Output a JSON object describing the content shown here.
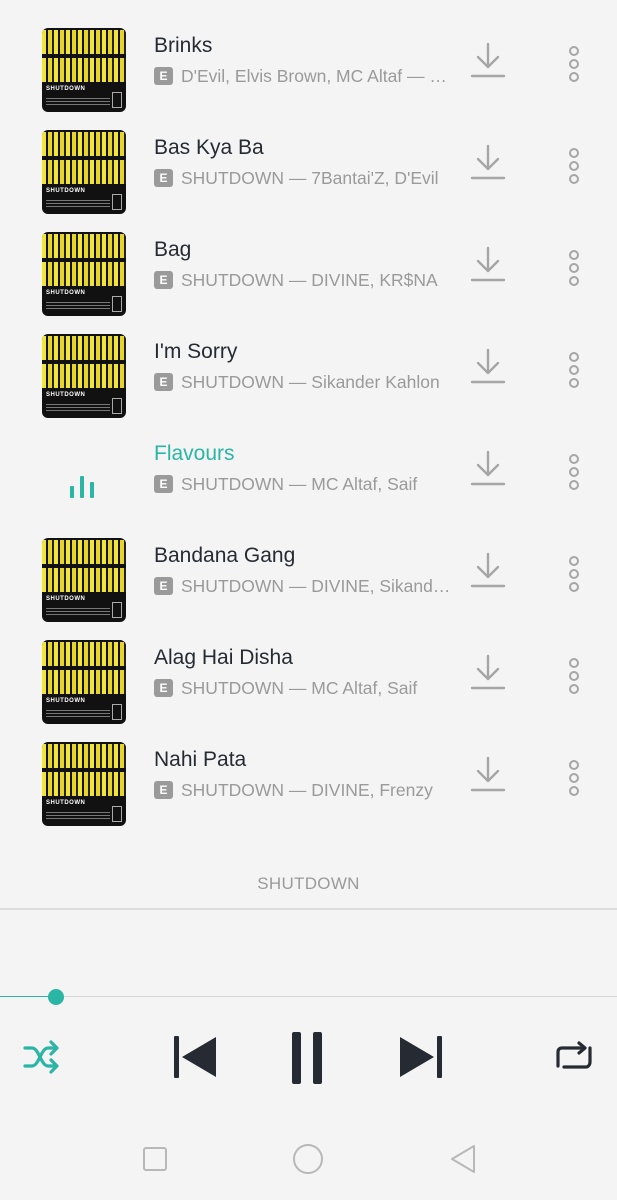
{
  "tracks": [
    {
      "title": "Brinks",
      "subtitle": "D'Evil, Elvis Brown, MC Altaf — SHUTDOWN",
      "explicit": "E",
      "active": false
    },
    {
      "title": "Bas Kya Ba",
      "subtitle": "SHUTDOWN — 7Bantai'Z, D'Evil",
      "explicit": "E",
      "active": false
    },
    {
      "title": "Bag",
      "subtitle": "SHUTDOWN — DIVINE, KR$NA",
      "explicit": "E",
      "active": false
    },
    {
      "title": "I'm Sorry",
      "subtitle": "SHUTDOWN — Sikander Kahlon",
      "explicit": "E",
      "active": false
    },
    {
      "title": "Flavours",
      "subtitle": "SHUTDOWN — MC Altaf, Saif",
      "explicit": "E",
      "active": true
    },
    {
      "title": "Bandana Gang",
      "subtitle": "SHUTDOWN — DIVINE, Sikander Kahlon",
      "explicit": "E",
      "active": false
    },
    {
      "title": "Alag Hai Disha",
      "subtitle": "SHUTDOWN — MC Altaf, Saif",
      "explicit": "E",
      "active": false
    },
    {
      "title": "Nahi Pata",
      "subtitle": "SHUTDOWN — DIVINE, Frenzy",
      "explicit": "E",
      "active": false
    }
  ],
  "cover_label": "SHUTDOWN",
  "album_footer": "SHUTDOWN",
  "playback": {
    "progress_fraction": 0.09,
    "state": "playing"
  },
  "icons": {
    "download": "download-icon",
    "more": "more-vertical-icon",
    "shuffle": "shuffle-icon",
    "previous": "skip-previous-icon",
    "pause": "pause-icon",
    "next": "skip-next-icon",
    "repeat": "repeat-icon",
    "equalizer": "equalizer-icon"
  },
  "colors": {
    "accent": "#2bb5a5",
    "text": "#262b33",
    "muted": "#9a9a9a",
    "background": "#f4f4f4"
  }
}
